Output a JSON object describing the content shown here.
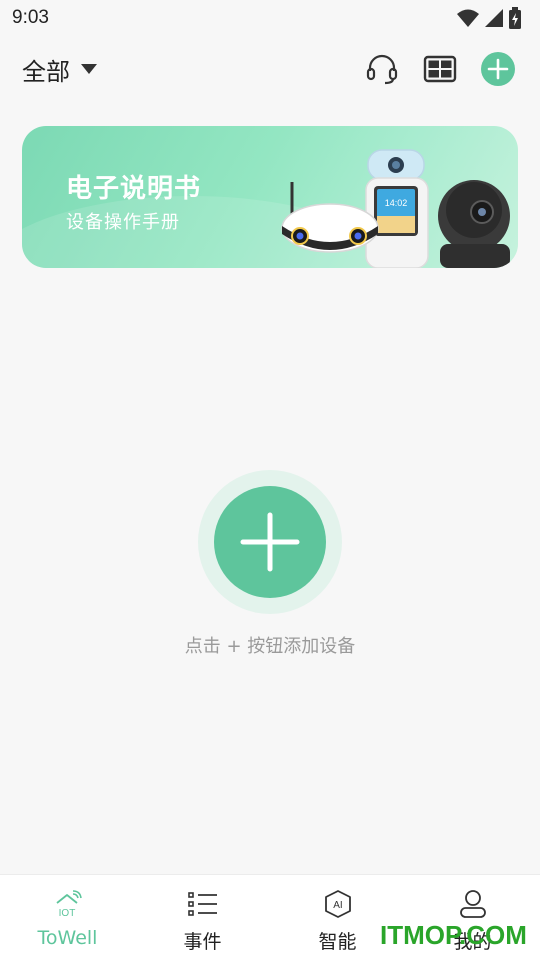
{
  "status_bar": {
    "time": "9:03"
  },
  "header": {
    "filter_label": "全部"
  },
  "banner": {
    "title": "电子说明书",
    "subtitle": "设备操作手册",
    "screen_time": "14:02"
  },
  "empty_state": {
    "hint": "点击 + 按钮添加设备"
  },
  "tabs": [
    {
      "label": "ToWell",
      "icon": "home-iot-icon",
      "active": true
    },
    {
      "label": "事件",
      "icon": "list-icon",
      "active": false
    },
    {
      "label": "智能",
      "icon": "ai-icon",
      "active": false
    },
    {
      "label": "我的",
      "icon": "user-icon",
      "active": false
    }
  ],
  "watermark": "ITMOP.COM",
  "colors": {
    "accent": "#5ec59c",
    "banner_start": "#7cd9b4",
    "banner_end": "#c6f2dd",
    "watermark": "#2aa52a"
  }
}
